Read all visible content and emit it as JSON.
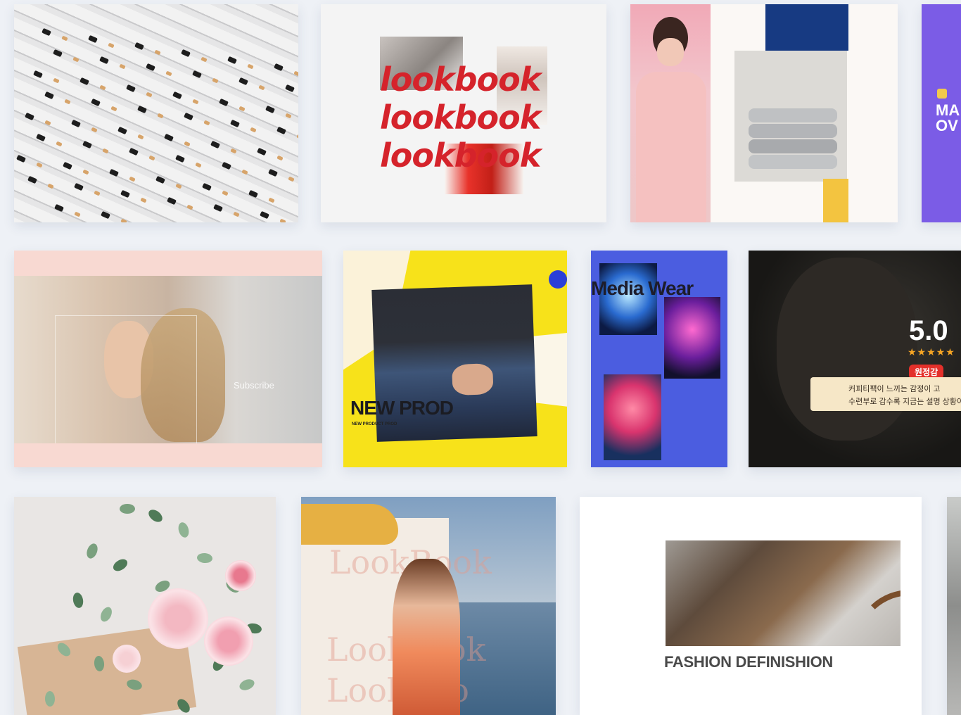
{
  "templates": [
    {
      "id": "pencils"
    },
    {
      "id": "lookbook-red",
      "lines": [
        "lookbook",
        "lookbook",
        "lookbook"
      ]
    },
    {
      "id": "pink-towels"
    },
    {
      "id": "purple-edge",
      "title_lines": [
        "MA",
        "OV"
      ]
    },
    {
      "id": "subscribe",
      "label": "Subscribe"
    },
    {
      "id": "new-product",
      "headline": "NEW PROD",
      "subline": "NEW PRODUCT PROD"
    },
    {
      "id": "media-wear",
      "headline": "Media Wear"
    },
    {
      "id": "review",
      "score": "5.0",
      "stars": "★★★★★",
      "badge": "원정감",
      "lines": [
        "커피티팩이 느끼는 감정이 고",
        "수련부로 감수록 지금는 설명 상황이"
      ]
    },
    {
      "id": "flowers"
    },
    {
      "id": "lookbook-beach",
      "ghost_lines": [
        "LookBook",
        "Lookbook",
        "LookBoo"
      ]
    },
    {
      "id": "fashion",
      "headline": "FASHION DEFINISHION"
    },
    {
      "id": "grey-edge"
    }
  ],
  "colors": {
    "background": "#eef1f6",
    "lookbook_red": "#d5232b",
    "navy": "#173a82",
    "purple": "#7b5ce6",
    "yellow": "#f7e21a",
    "blue": "#4b5de0",
    "star_orange": "#f5a524",
    "badge_red": "#e4302a"
  }
}
